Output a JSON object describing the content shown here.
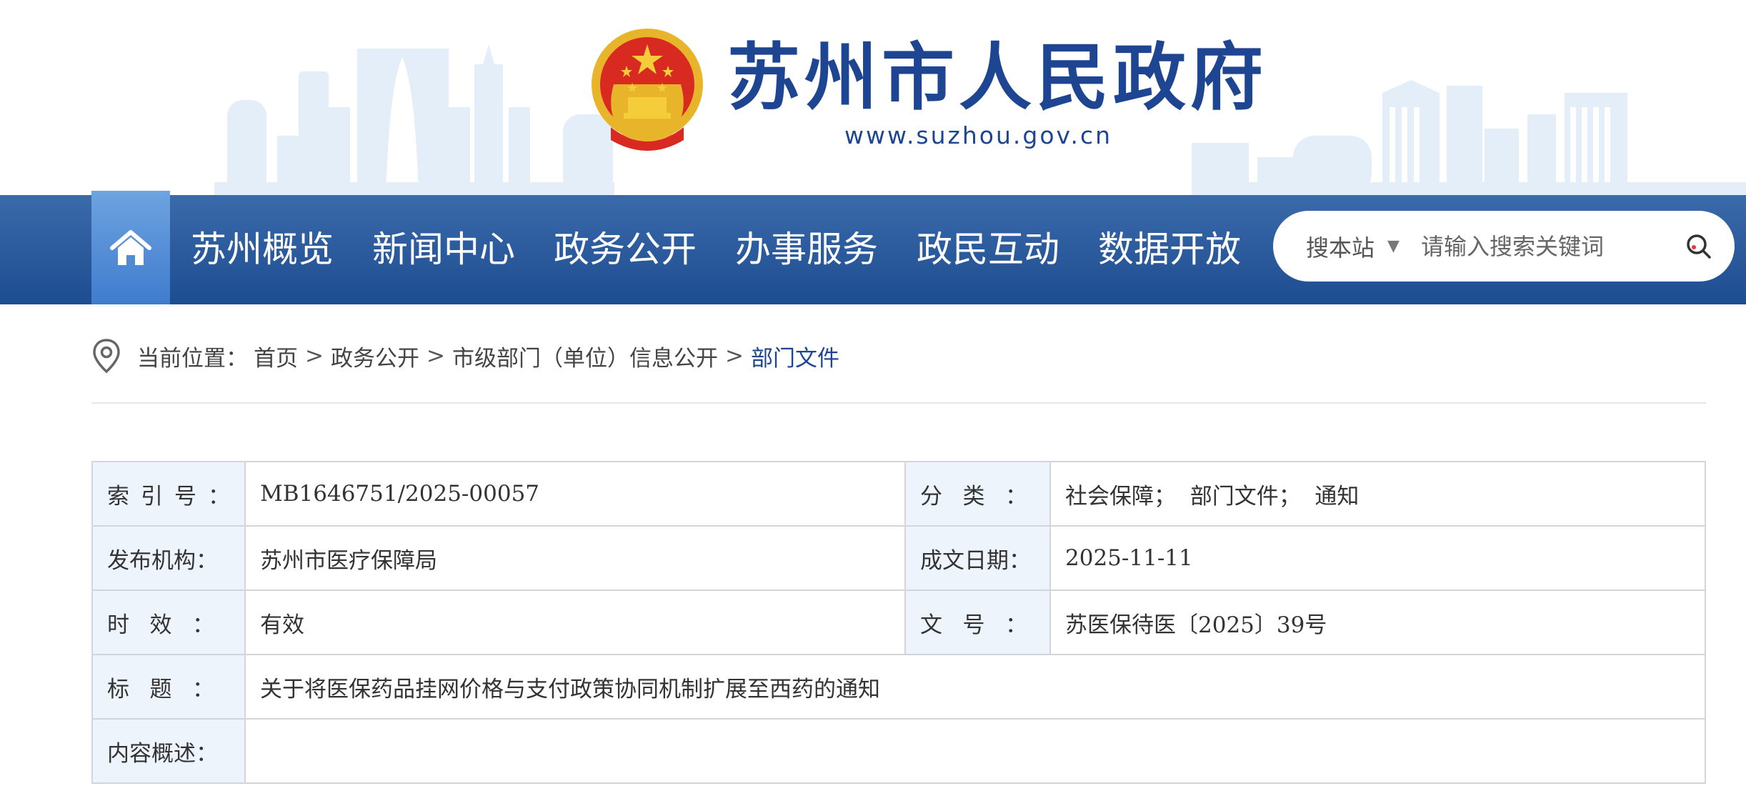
{
  "header": {
    "title": "苏州市人民政府",
    "url": "www.suzhou.gov.cn"
  },
  "nav": {
    "items": [
      "苏州概览",
      "新闻中心",
      "政务公开",
      "办事服务",
      "政民互动",
      "数据开放"
    ]
  },
  "search": {
    "scope": "搜本站",
    "placeholder": "请输入搜索关键词"
  },
  "breadcrumb": {
    "prefix": "当前位置：",
    "items": [
      "首页",
      "政务公开",
      "市级部门（单位）信息公开"
    ],
    "current": "部门文件",
    "separator": ">"
  },
  "info": {
    "rows": [
      {
        "label1": [
          "索",
          "引",
          "号",
          "："
        ],
        "value1": "MB1646751/2025-00057",
        "label2": [
          "分",
          "类",
          "："
        ],
        "value2": "社会保障；  部门文件；  通知"
      },
      {
        "label1": [
          "发布机构："
        ],
        "value1": "苏州市医疗保障局",
        "label2": [
          "成文日期："
        ],
        "value2": "2025-11-11"
      },
      {
        "label1": [
          "时",
          "效",
          "："
        ],
        "value1": "有效",
        "label2": [
          "文",
          "号",
          "："
        ],
        "value2": "苏医保待医〔2025〕39号"
      }
    ],
    "title_label": [
      "标",
      "题",
      "："
    ],
    "title_value": "关于将医保药品挂网价格与支付政策协同机制扩展至西药的通知",
    "summary_label": [
      "内容概述："
    ],
    "summary_value": ""
  },
  "colors": {
    "brand": "#1e4592",
    "nav_top": "#3b6aaa",
    "nav_bottom": "#1d4d91",
    "home_button": "#4f8ad6",
    "label_cell": "#edf4fc"
  }
}
